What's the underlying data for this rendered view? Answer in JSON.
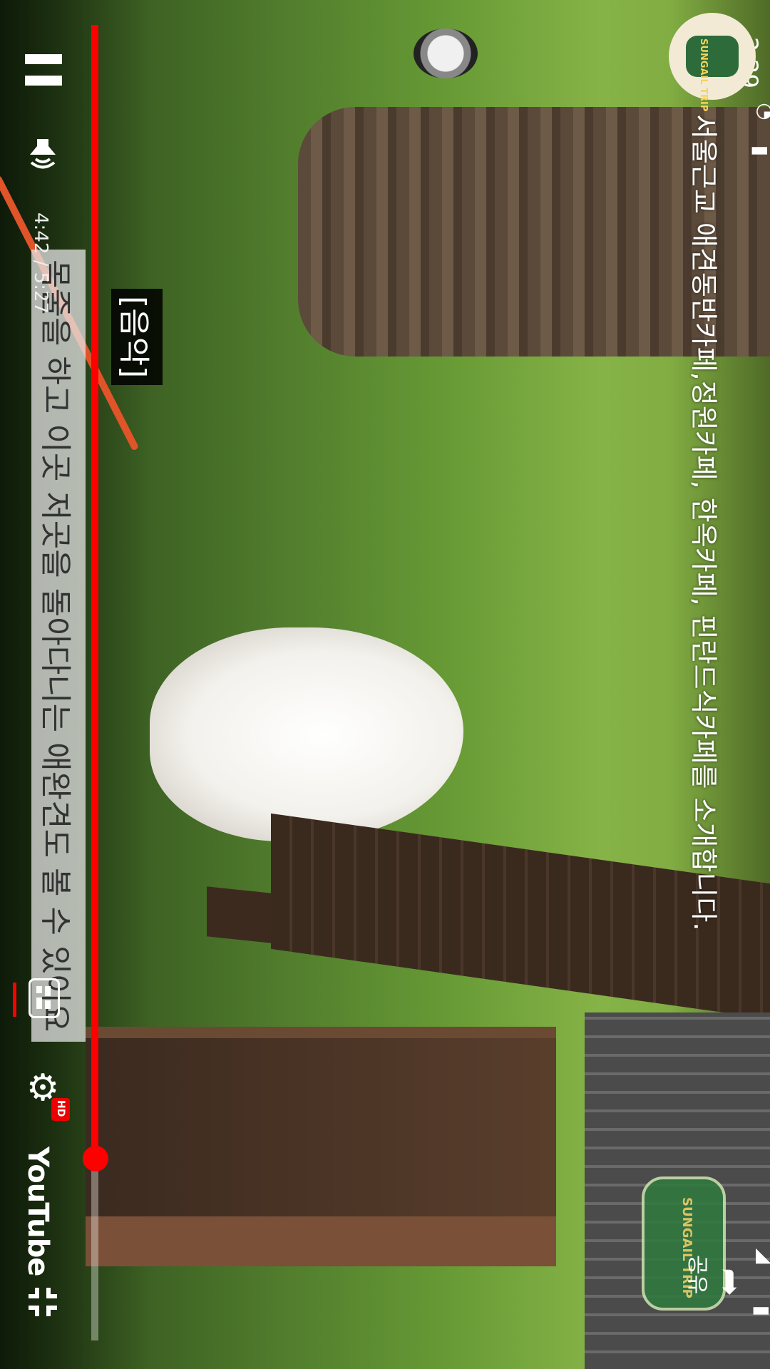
{
  "status_bar": {
    "time": "2:29"
  },
  "video": {
    "title": "서울근교 애견동반카페,정원카페, 한옥카페, 핀란드식카페를 소개합니다.",
    "caption_line": "목줄을 하고 이곳 저곳을 돌아다니는 애완견도 볼 수 있어요",
    "caption_music": "[음악]"
  },
  "player": {
    "time_readout": "4:42 / 5:27",
    "progress_fraction": 0.862,
    "hd_label": "HD",
    "brand_label": "YouTube",
    "share_label": "공유",
    "accent_color": "#FF0000"
  },
  "channel": {
    "avatar_text": "SUNGAIL TRIP",
    "watermark_text": "SUNGAIL TRIP"
  },
  "icons": {
    "pause": "pause-icon",
    "volume": "volume-icon",
    "captions": "captions-icon",
    "settings": "gear-icon",
    "fullscreen_exit": "fullscreen-exit-icon",
    "share": "share-icon"
  }
}
